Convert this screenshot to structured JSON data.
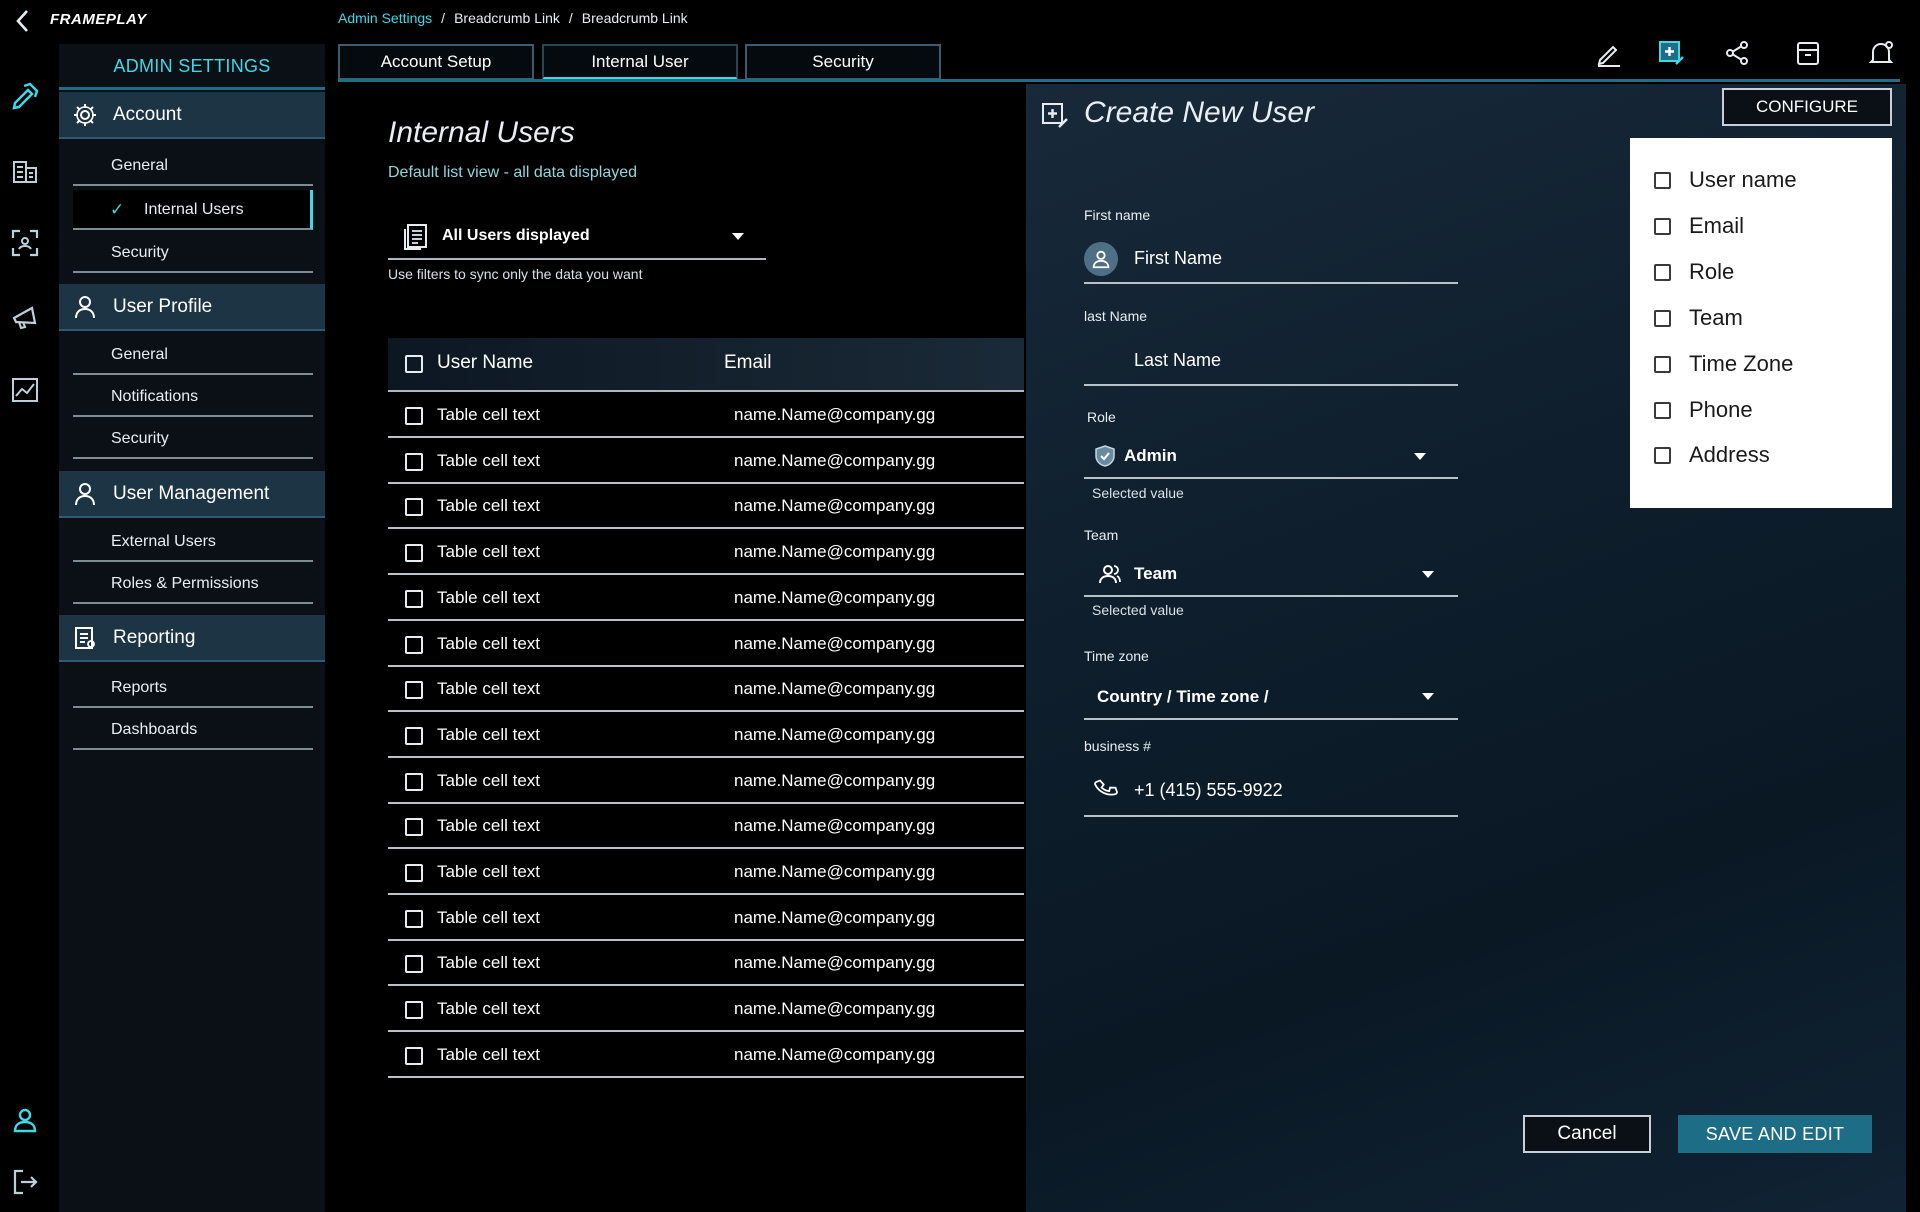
{
  "app": {
    "brand": "FRAMEPLAY"
  },
  "breadcrumb": {
    "items": [
      "Admin Settings",
      "Breadcrumb Link",
      "Breadcrumb Link"
    ]
  },
  "rail_icons": [
    "pencil-ruler-icon",
    "building-icon",
    "scan-icon",
    "megaphone-icon",
    "chart-icon",
    "user-icon",
    "logout-icon"
  ],
  "sidebar": {
    "title": "ADMIN SETTINGS",
    "sections": [
      {
        "label": "Account",
        "icon": "gear-icon",
        "items": [
          "General",
          "Internal Users",
          "Security"
        ]
      },
      {
        "label": "User Profile",
        "icon": "user-icon",
        "items": [
          "General",
          "Notifications",
          "Security"
        ]
      },
      {
        "label": "User Management",
        "icon": "user-icon",
        "items": [
          "External Users",
          "Roles & Permissions"
        ]
      },
      {
        "label": "Reporting",
        "icon": "report-icon",
        "items": [
          "Reports",
          "Dashboards"
        ]
      }
    ]
  },
  "tabs": [
    "Account Setup",
    "Internal User",
    "Security"
  ],
  "toolbar_icons": [
    "edit-icon",
    "add-note-icon",
    "share-icon",
    "archive-icon",
    "bell-icon"
  ],
  "list": {
    "title": "Internal Users",
    "subtitle": "Default list view - all data displayed",
    "filter_label": "All Users displayed",
    "filter_help": "Use filters to sync only the data you want",
    "columns": [
      "User Name",
      "Email"
    ],
    "rows": [
      [
        "Table cell text",
        "name.Name@company.gg"
      ],
      [
        "Table cell text",
        "name.Name@company.gg"
      ],
      [
        "Table cell text",
        "name.Name@company.gg"
      ],
      [
        "Table cell text",
        "name.Name@company.gg"
      ],
      [
        "Table cell text",
        "name.Name@company.gg"
      ],
      [
        "Table cell text",
        "name.Name@company.gg"
      ],
      [
        "Table cell text",
        "name.Name@company.gg"
      ],
      [
        "Table cell text",
        "name.Name@company.gg"
      ],
      [
        "Table cell text",
        "name.Name@company.gg"
      ],
      [
        "Table cell text",
        "name.Name@company.gg"
      ],
      [
        "Table cell text",
        "name.Name@company.gg"
      ],
      [
        "Table cell text",
        "name.Name@company.gg"
      ],
      [
        "Table cell text",
        "name.Name@company.gg"
      ],
      [
        "Table cell text",
        "name.Name@company.gg"
      ],
      [
        "Table cell text",
        "name.Name@company.gg"
      ]
    ]
  },
  "create": {
    "title": "Create New User",
    "first_name_label": "First name",
    "first_name_value": "First Name",
    "last_name_label": "last Name",
    "last_name_value": "Last Name",
    "role_label": "Role",
    "role_value": "Admin",
    "role_help": "Selected value",
    "team_label": "Team",
    "team_value": "Team",
    "team_help": "Selected value",
    "tz_label": "Time zone",
    "tz_value": "Country / Time zone /",
    "phone_label": "business #",
    "phone_value": "+1 (415) 555-9922",
    "cancel": "Cancel",
    "save": "SAVE AND EDIT"
  },
  "configure": {
    "button": "CONFIGURE",
    "options": [
      "User name",
      "Email",
      "Role",
      "Team",
      "Time Zone",
      "Phone",
      "Address"
    ]
  }
}
